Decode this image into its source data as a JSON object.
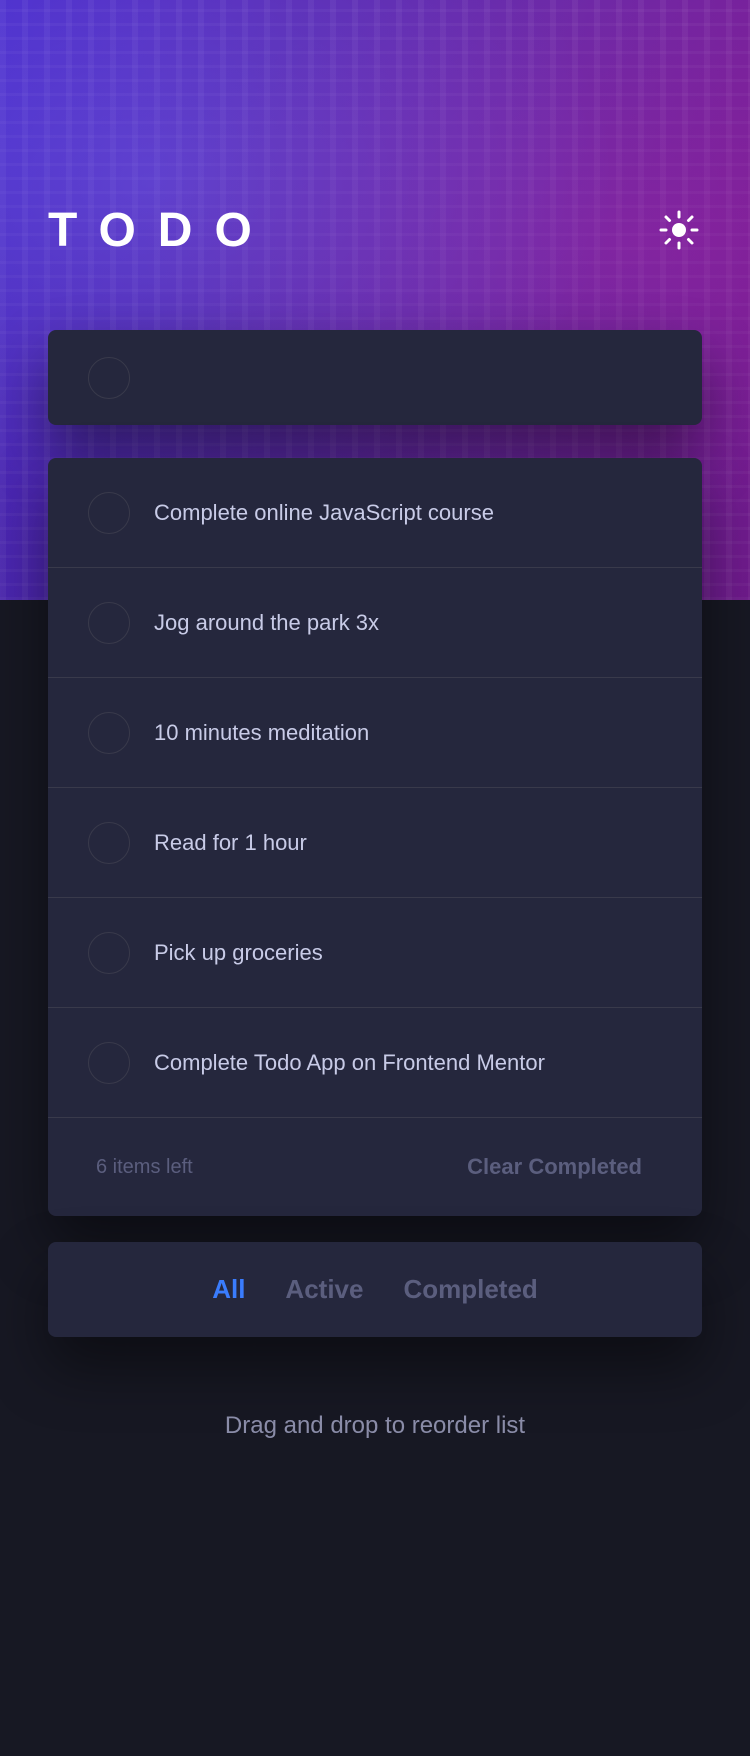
{
  "app": {
    "title": "TODO",
    "theme_icon": "sun-icon"
  },
  "new_todo": {
    "placeholder": "",
    "value": ""
  },
  "todos": [
    {
      "text": "Complete online JavaScript course",
      "completed": false
    },
    {
      "text": "Jog around the park 3x",
      "completed": false
    },
    {
      "text": "10 minutes meditation",
      "completed": false
    },
    {
      "text": "Read for 1 hour",
      "completed": false
    },
    {
      "text": "Pick up groceries",
      "completed": false
    },
    {
      "text": "Complete Todo App on Frontend Mentor",
      "completed": false
    }
  ],
  "footer": {
    "items_left": "6 items left",
    "clear_label": "Clear Completed"
  },
  "filters": {
    "all": "All",
    "active": "Active",
    "completed": "Completed",
    "selected": "All"
  },
  "hint": "Drag and drop to reorder list",
  "colors": {
    "accent": "#3a7cfd",
    "card": "#25273d",
    "background": "#171823",
    "text": "#c8cbe7",
    "muted": "#5b5e7e"
  }
}
